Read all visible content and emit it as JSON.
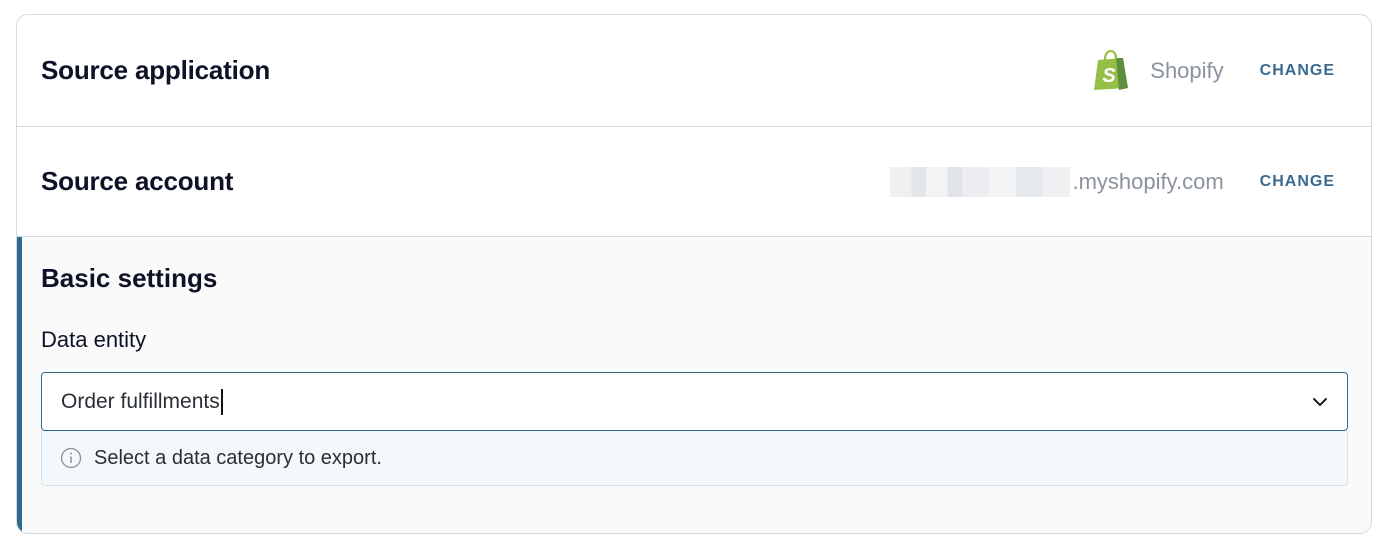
{
  "source_application": {
    "title": "Source application",
    "app_icon": "shopify-bag-icon",
    "app_name": "Shopify",
    "change_label": "CHANGE"
  },
  "source_account": {
    "title": "Source account",
    "domain_suffix": ".myshopify.com",
    "change_label": "CHANGE"
  },
  "basic_settings": {
    "title": "Basic settings",
    "data_entity": {
      "label": "Data entity",
      "value": "Order fulfillments",
      "hint": "Select a data category to export."
    }
  },
  "colors": {
    "accent": "#2e6a90",
    "change_link": "#3b6a8f",
    "shopify_green": "#95bf47"
  }
}
